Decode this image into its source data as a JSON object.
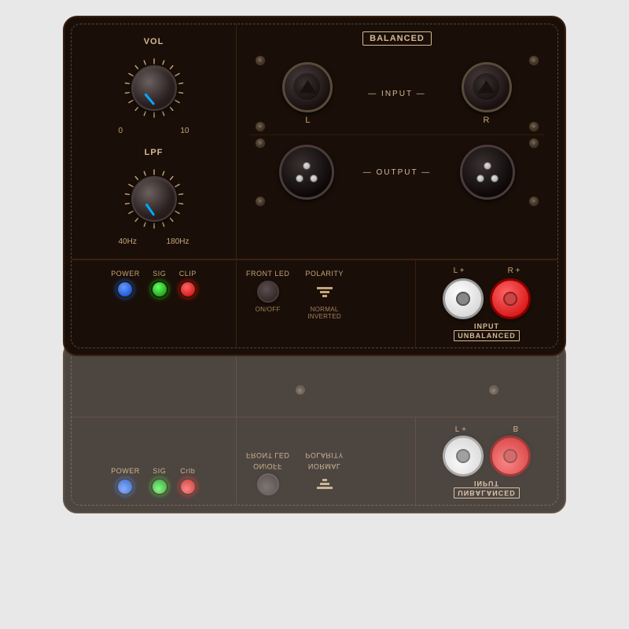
{
  "panel": {
    "background_color": "#1a0f08",
    "border_color": "#3a2010"
  },
  "knobs": {
    "vol": {
      "label": "VOL",
      "min": "0",
      "max": "10",
      "indicator_color": "#00aaff"
    },
    "lpf": {
      "label": "LPF",
      "min": "40Hz",
      "max": "180Hz",
      "indicator_color": "#00aaff"
    }
  },
  "balanced_section": {
    "label": "BALANCED",
    "input_label": "— INPUT —",
    "output_label": "— OUTPUT —",
    "channels": {
      "left": "L",
      "right": "R"
    }
  },
  "indicators": {
    "power": {
      "label": "POWER",
      "color": "blue"
    },
    "sig": {
      "label": "SIG",
      "color": "green"
    },
    "clip": {
      "label": "CLIP",
      "color": "red"
    }
  },
  "controls": {
    "front_led": {
      "label": "FRONT LED",
      "sublabel1": "ON/OFF"
    },
    "polarity": {
      "label": "POLARITY",
      "sublabel1": "NORMAL",
      "sublabel2": "INVERTED"
    }
  },
  "unbalanced": {
    "label": "INPUT",
    "sublabel": "UNBALANCED",
    "left_label": "L",
    "right_label": "R",
    "plus": "+",
    "minus": "−"
  }
}
